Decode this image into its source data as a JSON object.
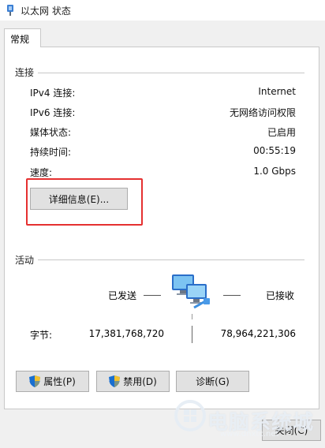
{
  "window": {
    "title": "以太网 状态"
  },
  "tabs": [
    {
      "label": "常规"
    }
  ],
  "connection": {
    "section_title": "连接",
    "rows": [
      {
        "label": "IPv4 连接:",
        "value": "Internet"
      },
      {
        "label": "IPv6 连接:",
        "value": "无网络访问权限"
      },
      {
        "label": "媒体状态:",
        "value": "已启用"
      },
      {
        "label": "持续时间:",
        "value": "00:55:19"
      },
      {
        "label": "速度:",
        "value": "1.0 Gbps"
      }
    ],
    "details_button": "详细信息(E)..."
  },
  "activity": {
    "section_title": "活动",
    "sent_label": "已发送",
    "received_label": "已接收",
    "bytes_label": "字节:",
    "bytes_sent": "17,381,768,720",
    "bytes_received": "78,964,221,306"
  },
  "buttons": {
    "properties": "属性(P)",
    "disable": "禁用(D)",
    "diagnose": "诊断(G)",
    "close": "关闭(C)"
  },
  "watermark": {
    "text": "电脑系统城",
    "sub": "www.dnxtc.net"
  },
  "colors": {
    "highlight": "#e53030",
    "accent_blue": "#1a6fd0"
  }
}
